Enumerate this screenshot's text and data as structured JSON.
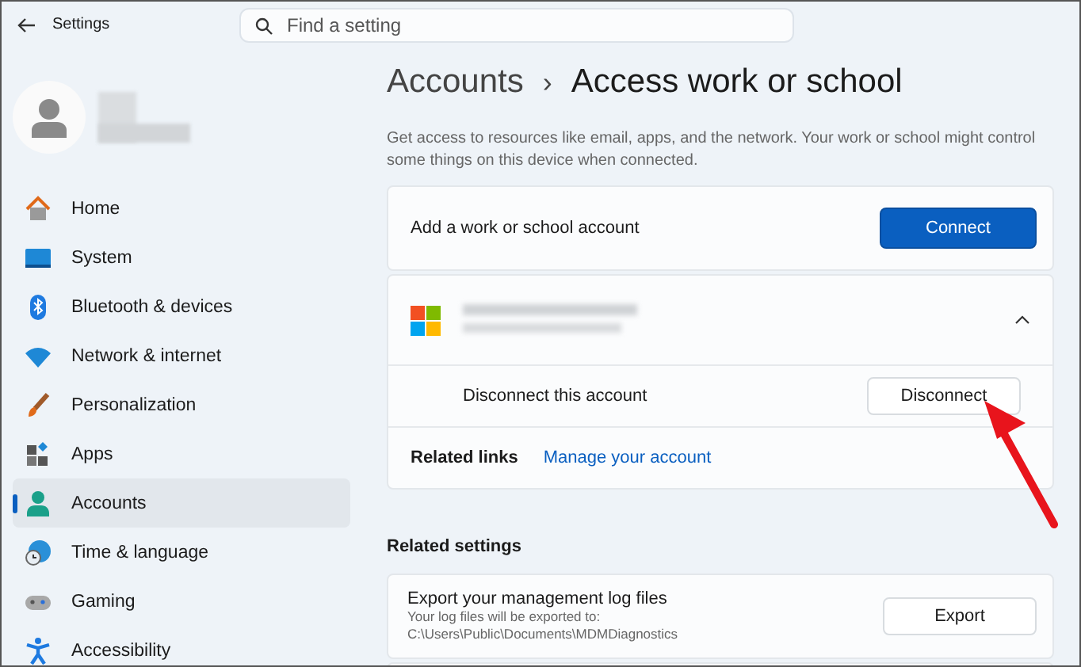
{
  "window": {
    "title": "Settings"
  },
  "search": {
    "placeholder": "Find a setting"
  },
  "nav": [
    {
      "label": "Home",
      "selected": false
    },
    {
      "label": "System",
      "selected": false
    },
    {
      "label": "Bluetooth & devices",
      "selected": false
    },
    {
      "label": "Network & internet",
      "selected": false
    },
    {
      "label": "Personalization",
      "selected": false
    },
    {
      "label": "Apps",
      "selected": false
    },
    {
      "label": "Accounts",
      "selected": true
    },
    {
      "label": "Time & language",
      "selected": false
    },
    {
      "label": "Gaming",
      "selected": false
    },
    {
      "label": "Accessibility",
      "selected": false
    }
  ],
  "breadcrumb": {
    "parent": "Accounts",
    "separator": "›",
    "current": "Access work or school"
  },
  "description": "Get access to resources like email, apps, and the network. Your work or school might control some things on this device when connected.",
  "add_account": {
    "label": "Add a work or school account",
    "button": "Connect"
  },
  "account": {
    "expanded": true,
    "disconnect_label": "Disconnect this account",
    "disconnect_button": "Disconnect",
    "related_links_label": "Related links",
    "link": "Manage your account"
  },
  "related_settings": {
    "heading": "Related settings",
    "items": [
      {
        "title": "Export your management log files",
        "description": "Your log files will be exported to: C:\\Users\\Public\\Documents\\MDMDiagnostics",
        "button": "Export"
      }
    ]
  }
}
